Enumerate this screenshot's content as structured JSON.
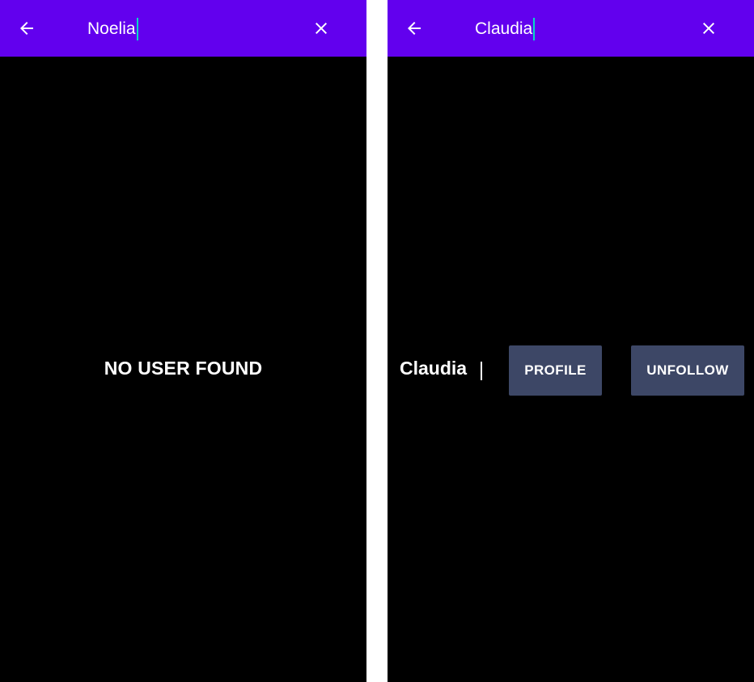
{
  "colors": {
    "appbar": "#6200ee",
    "background": "#000000",
    "caret": "#03dac5",
    "button": "#3d4766",
    "text": "#ffffff"
  },
  "screens": [
    {
      "back_icon": "arrow-back-icon",
      "search_value": "Noelia",
      "clear_icon": "close-icon",
      "empty_message": "NO USER FOUND"
    },
    {
      "back_icon": "arrow-back-icon",
      "search_value": "Claudia",
      "clear_icon": "close-icon",
      "result": {
        "name": "Claudia",
        "profile_label": "PROFILE",
        "unfollow_label": "UNFOLLOW"
      }
    }
  ]
}
